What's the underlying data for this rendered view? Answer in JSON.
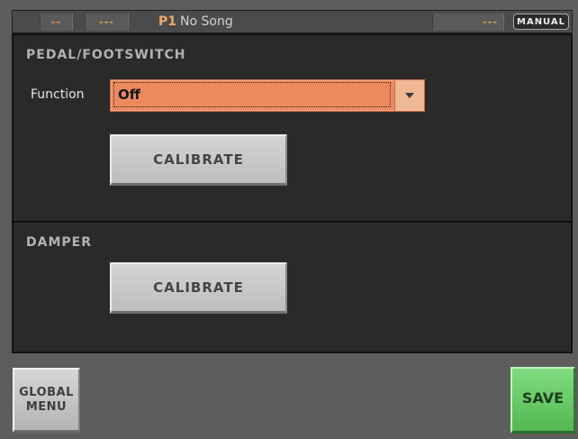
{
  "header": {
    "seg1": "--",
    "seg2": "---",
    "program_number": "P1",
    "song_name": "No Song",
    "seg3": "---",
    "mode_badge": "MANUAL"
  },
  "pedal_section": {
    "title": "PEDAL/FOOTSWITCH",
    "function_label": "Function",
    "function_value": "Off",
    "calibrate_label": "CALIBRATE"
  },
  "damper_section": {
    "title": "DAMPER",
    "calibrate_label": "CALIBRATE"
  },
  "footer": {
    "global_menu_line1": "GLOBAL",
    "global_menu_line2": "MENU",
    "save_label": "SAVE"
  },
  "colors": {
    "dropdown_bg": "#ec8a5e",
    "save_bg": "#6ccc6c",
    "accent_text": "#f0a868"
  }
}
